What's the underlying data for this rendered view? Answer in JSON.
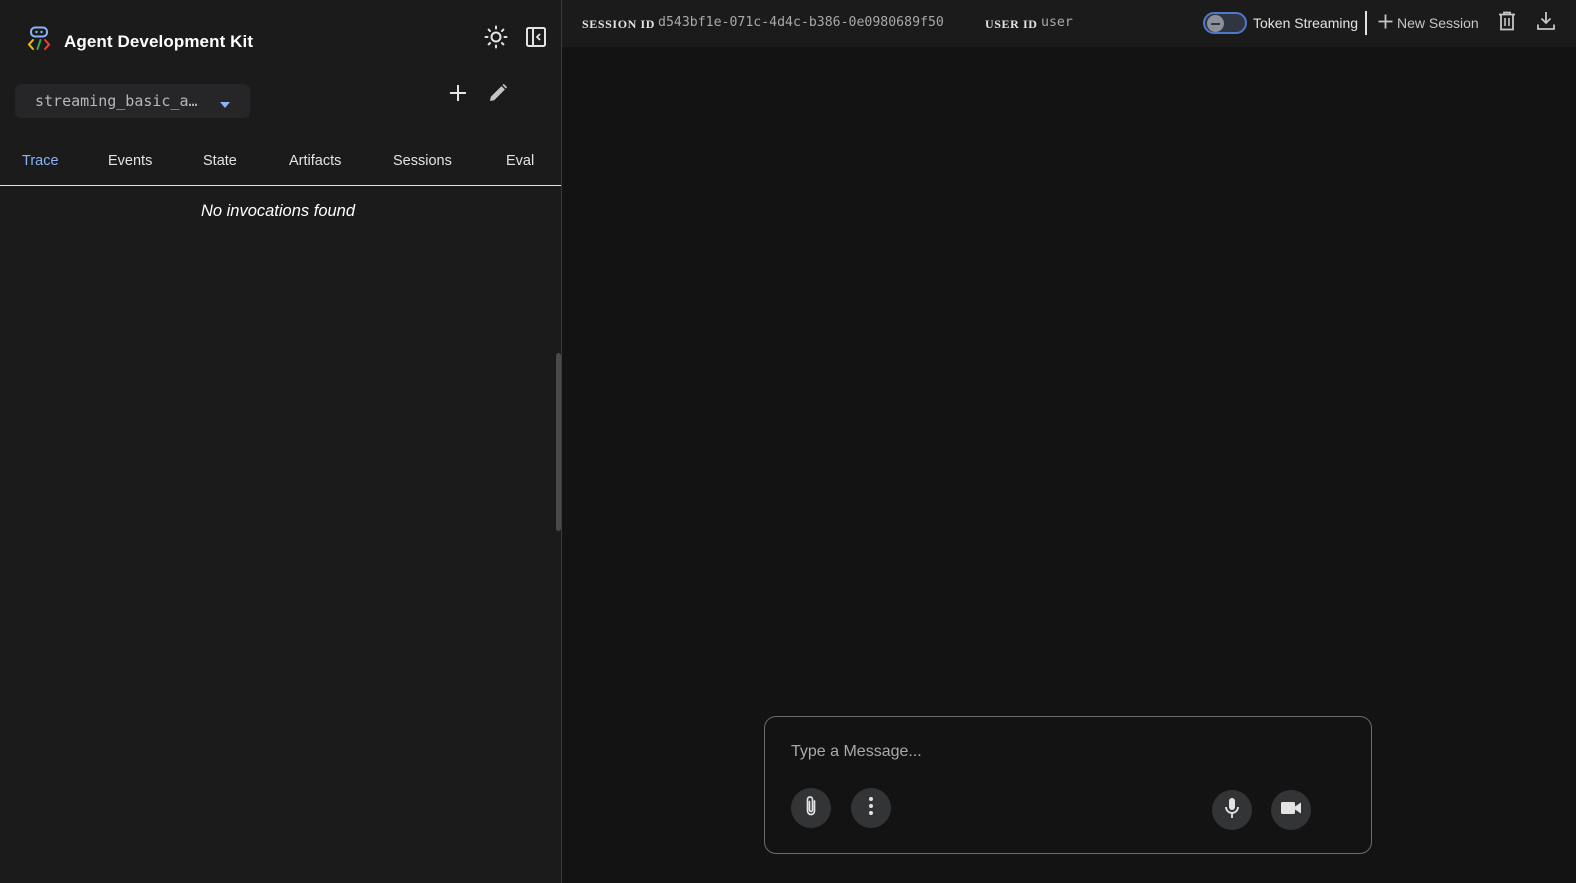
{
  "sidebar": {
    "brand_title": "Agent Development Kit",
    "agent_select": {
      "value": "streaming_basic_a…"
    },
    "tabs": [
      {
        "label": "Trace",
        "active": true
      },
      {
        "label": "Events",
        "active": false
      },
      {
        "label": "State",
        "active": false
      },
      {
        "label": "Artifacts",
        "active": false
      },
      {
        "label": "Sessions",
        "active": false
      },
      {
        "label": "Eval",
        "active": false
      }
    ],
    "empty_message": "No invocations found",
    "icons": {
      "theme": "light-mode-sun-icon",
      "collapse": "side-panel-collapse-icon",
      "add": "plus-icon",
      "edit": "pencil-icon",
      "caret": "arrow-drop-down-icon"
    }
  },
  "header": {
    "session_label": "SESSION ID",
    "session_id": "d543bf1e-071c-4d4c-b386-0e0980689f50",
    "user_label": "USER ID",
    "user_id": "user",
    "token_streaming_label": "Token Streaming",
    "token_streaming_enabled": false,
    "new_session_label": "New Session",
    "icons": {
      "delete": "trash-icon",
      "download": "download-icon"
    }
  },
  "composer": {
    "placeholder": "Type a Message...",
    "value": "",
    "icons": {
      "attach": "paperclip-icon",
      "more": "more-vert-icon",
      "mic": "microphone-icon",
      "video": "videocam-icon"
    }
  },
  "colors": {
    "accent": "#8ab4f8",
    "background": "#131314",
    "panel": "#1b1b1c",
    "toggle_border": "#4f78c8"
  }
}
